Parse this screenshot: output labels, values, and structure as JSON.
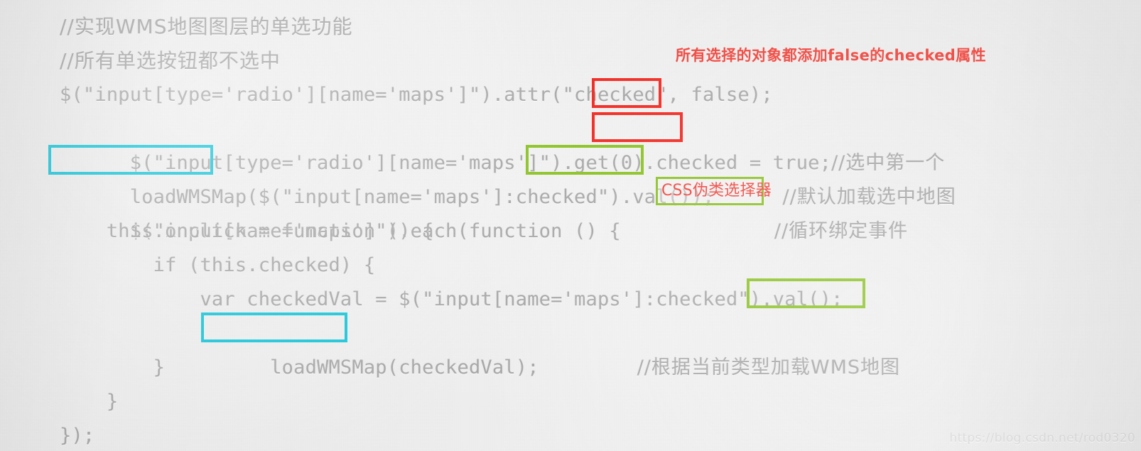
{
  "document": {
    "kind": "scanned-code-listing",
    "language": "JavaScript / jQuery",
    "watermark": "https://blog.csdn.net/rod0320"
  },
  "code_lines": [
    {
      "id": "l1",
      "text": "//实现WMS地图图层的单选功能",
      "style": "comment"
    },
    {
      "id": "l2",
      "text": "//所有单选按钮都不选中",
      "style": "comment"
    },
    {
      "id": "l3",
      "text": "$(\"input[type='radio'][name='maps']\").attr(\"checked\", false);",
      "style": "code"
    },
    {
      "id": "l4",
      "text": "$(\"input[type='radio'][name='maps']\").get(0).checked = true;",
      "style": "code",
      "trailing_comment": "//选中第一个"
    },
    {
      "id": "l5",
      "text": "loadWMSMap($(\"input[name='maps']:checked\").val());",
      "style": "code",
      "trailing_comment": "//默认加载选中地图"
    },
    {
      "id": "l6",
      "text": "$(\"input[name='maps']\").each(function () {",
      "style": "code",
      "trailing_comment": "//循环绑定事件"
    },
    {
      "id": "l7",
      "text": "    this.onclick = function () {",
      "style": "code"
    },
    {
      "id": "l8",
      "text": "        if (this.checked) {",
      "style": "code"
    },
    {
      "id": "l9",
      "text": "            var checkedVal = $(\"input[name='maps']:checked\").val();",
      "style": "code"
    },
    {
      "id": "l10",
      "text": "            loadWMSMap(checkedVal);",
      "style": "code",
      "trailing_comment": "//根据当前类型加载WMS地图"
    },
    {
      "id": "l11",
      "text": "        }",
      "style": "code"
    },
    {
      "id": "l12",
      "text": "    }",
      "style": "code"
    },
    {
      "id": "l13",
      "text": "});",
      "style": "code"
    }
  ],
  "annotations": {
    "top_note": "所有选择的对象都添加false的checked属性",
    "css_note": "CSS伪类选择器"
  },
  "highlights": [
    {
      "id": "h-attr",
      "target": ".attr",
      "color": "#f42a22",
      "line": "l3"
    },
    {
      "id": "h-get0",
      "target": ".get(0)",
      "color": "#f42a22",
      "line": "l4"
    },
    {
      "id": "h-loadwms-1",
      "target": "loadWMSMap",
      "color": "#16c7db",
      "line": "l5"
    },
    {
      "id": "h-checked-1",
      "target": ":checked\"",
      "color": "#8dc424",
      "line": "l5"
    },
    {
      "id": "h-checked-2",
      "target": ":checked\"",
      "color": "#8dc424",
      "line": "l9"
    },
    {
      "id": "h-loadwms-2",
      "target": "loadWMSMap",
      "color": "#16c7db",
      "line": "l10"
    }
  ],
  "colors": {
    "background": "#eeeeee",
    "code_text": "#a9a9a9",
    "annotation_red": "#f4453c",
    "box_red": "#f42a22",
    "box_cyan": "#16c7db",
    "box_green": "#8dc424",
    "watermark": "#dcdcdc"
  }
}
